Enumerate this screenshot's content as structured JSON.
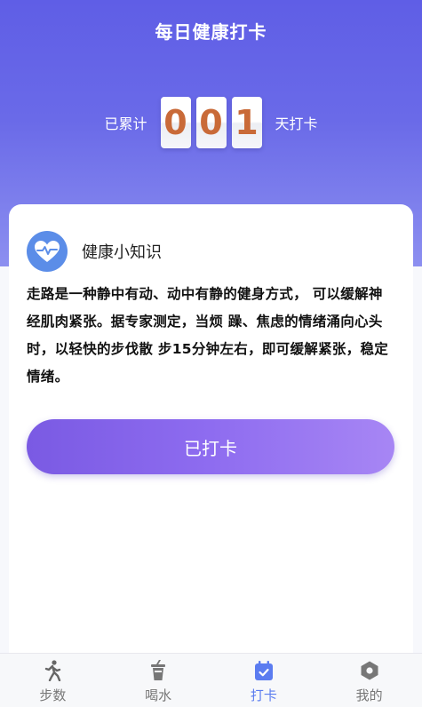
{
  "header": {
    "title": "每日健康打卡",
    "streak_prefix": "已累计",
    "streak_digits": [
      "0",
      "0",
      "1"
    ],
    "streak_suffix": "天打卡"
  },
  "tip": {
    "icon": "heart-pulse-icon",
    "title": "健康小知识",
    "body": "走路是一种静中有动、动中有静的健身方式， 可以缓解神经肌肉紧张。据专家测定，当烦 躁、焦虑的情绪涌向心头时，以轻快的步伐散 步15分钟左右，即可缓解紧张，稳定情绪。"
  },
  "checkin_button": {
    "label": "已打卡"
  },
  "tabbar": {
    "items": [
      {
        "label": "步数",
        "icon": "walking-icon",
        "active": false
      },
      {
        "label": "喝水",
        "icon": "cup-icon",
        "active": false
      },
      {
        "label": "打卡",
        "icon": "calendar-check-icon",
        "active": true
      },
      {
        "label": "我的",
        "icon": "hexagon-settings-icon",
        "active": false
      }
    ]
  },
  "colors": {
    "header_gradient_top": "#5f5ee6",
    "header_gradient_bottom": "#8c8ff0",
    "digit_color": "#c96a38",
    "button_gradient_start": "#7a5ae3",
    "button_gradient_end": "#a786f4",
    "tab_active": "#5b7cf0",
    "tab_inactive": "#777777",
    "heart_badge": "#5b8de8"
  }
}
